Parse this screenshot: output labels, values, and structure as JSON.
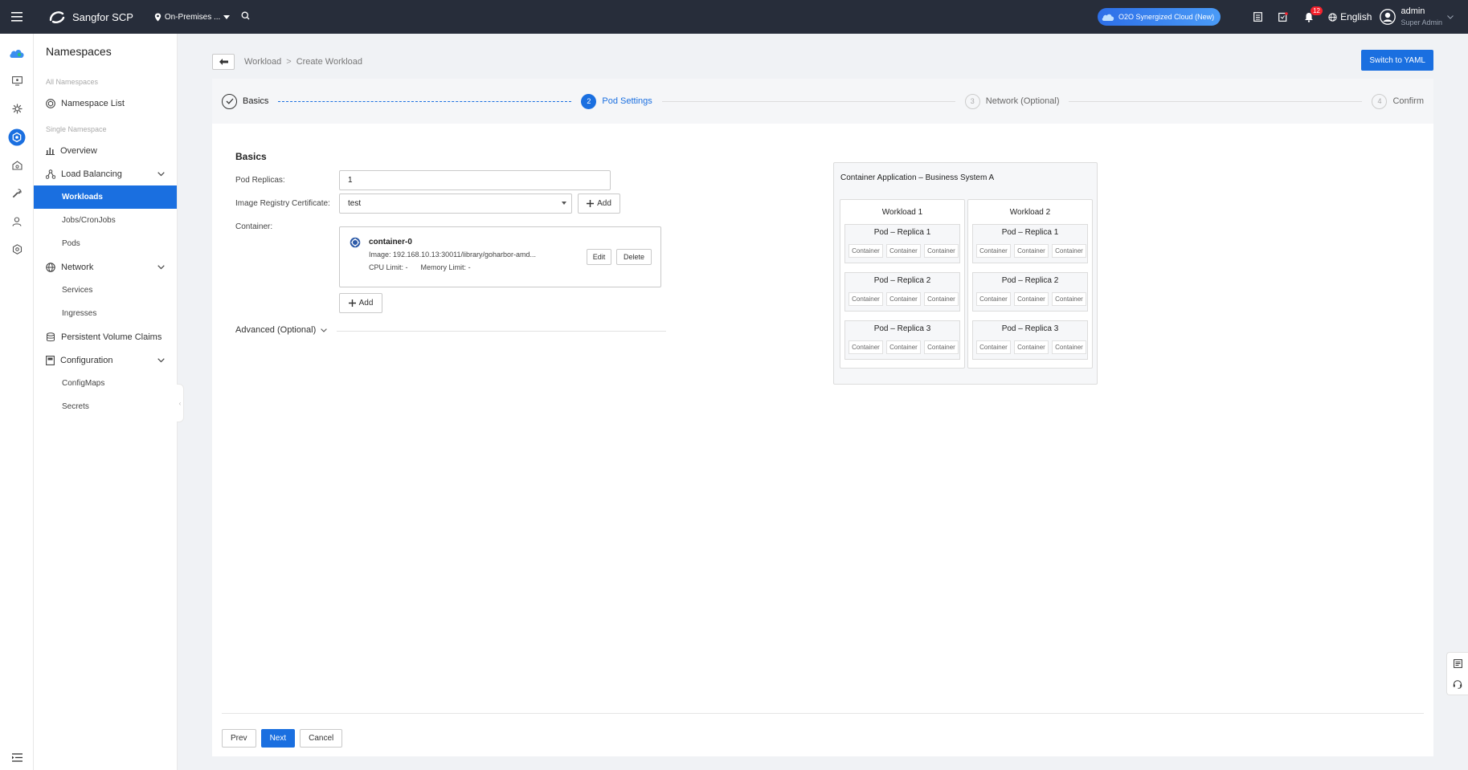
{
  "app": {
    "title": "Sangfor SCP",
    "environment": "On-Premises ...",
    "o2o_badge": "O2O Synergized Cloud (New)",
    "notifications_count": "12",
    "language": "English",
    "user_name": "admin",
    "user_role": "Super Admin"
  },
  "sidebar": {
    "title": "Namespaces",
    "section_all": "All Namespaces",
    "namespace_list": "Namespace List",
    "section_single": "Single Namespace",
    "overview": "Overview",
    "load_balancing": "Load Balancing",
    "workloads": "Workloads",
    "jobs": "Jobs/CronJobs",
    "pods": "Pods",
    "network": "Network",
    "services": "Services",
    "ingresses": "Ingresses",
    "pvc": "Persistent Volume Claims",
    "configuration": "Configuration",
    "configmaps": "ConfigMaps",
    "secrets": "Secrets"
  },
  "breadcrumb": {
    "parent": "Workload",
    "separator": ">",
    "current": "Create Workload"
  },
  "switch_yaml": "Switch to YAML",
  "steps": [
    {
      "num": "",
      "label": "Basics"
    },
    {
      "num": "2",
      "label": "Pod Settings"
    },
    {
      "num": "3",
      "label": "Network (Optional)"
    },
    {
      "num": "4",
      "label": "Confirm"
    }
  ],
  "form": {
    "section_title": "Basics",
    "replicas_label": "Pod Replicas:",
    "replicas_value": "1",
    "cert_label": "Image Registry Certificate:",
    "cert_value": "test",
    "add_label": "Add",
    "container_label": "Container:",
    "container_name": "container-0",
    "image_label": "Image:",
    "image_value": "192.168.10.13:30011/library/goharbor-amd...",
    "cpu_label": "CPU Limit:",
    "cpu_value": "-",
    "memory_label": "Memory Limit:",
    "memory_value": "-",
    "edit_label": "Edit",
    "delete_label": "Delete",
    "advanced_label": "Advanced (Optional)"
  },
  "diagram": {
    "title": "Container Application – Business System A",
    "workloads": [
      {
        "title": "Workload 1",
        "pods": [
          {
            "title": "Pod – Replica 1",
            "containers": [
              "Container",
              "Container",
              "Container"
            ]
          },
          {
            "title": "Pod – Replica 2",
            "containers": [
              "Container",
              "Container",
              "Container"
            ]
          },
          {
            "title": "Pod – Replica 3",
            "containers": [
              "Container",
              "Container",
              "Container"
            ]
          }
        ]
      },
      {
        "title": "Workload 2",
        "pods": [
          {
            "title": "Pod – Replica 1",
            "containers": [
              "Container",
              "Container",
              "Container"
            ]
          },
          {
            "title": "Pod – Replica 2",
            "containers": [
              "Container",
              "Container",
              "Container"
            ]
          },
          {
            "title": "Pod – Replica 3",
            "containers": [
              "Container",
              "Container",
              "Container"
            ]
          }
        ]
      }
    ]
  },
  "footer": {
    "prev": "Prev",
    "next": "Next",
    "cancel": "Cancel"
  },
  "colors": {
    "primary": "#1a6fe0",
    "topbar": "#272d3a"
  }
}
